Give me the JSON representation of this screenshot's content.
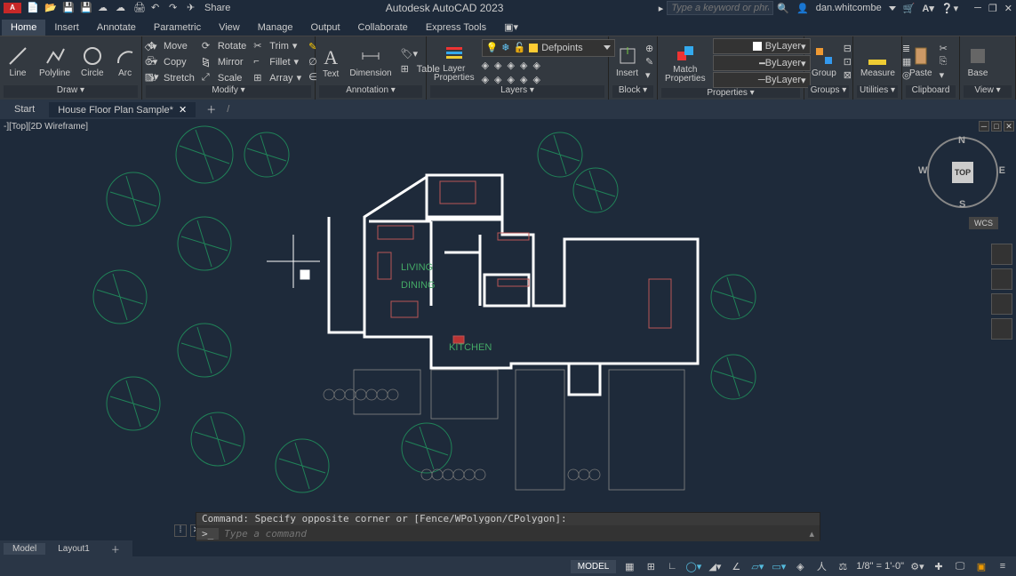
{
  "app": {
    "title": "Autodesk AutoCAD 2023",
    "logo_text": "A CAD",
    "share": "Share",
    "search_placeholder": "Type a keyword or phrase",
    "username": "dan.whitcombe"
  },
  "menu_tabs": [
    "Home",
    "Insert",
    "Annotate",
    "Parametric",
    "View",
    "Manage",
    "Output",
    "Collaborate",
    "Express Tools"
  ],
  "menu_active": 0,
  "ribbon": {
    "draw": {
      "label": "Draw ▾",
      "items": [
        "Line",
        "Polyline",
        "Circle",
        "Arc"
      ]
    },
    "modify": {
      "label": "Modify ▾",
      "move": "Move",
      "rotate": "Rotate",
      "trim": "Trim",
      "copy": "Copy",
      "mirror": "Mirror",
      "fillet": "Fillet",
      "stretch": "Stretch",
      "scale": "Scale",
      "array": "Array"
    },
    "annotation": {
      "label": "Annotation ▾",
      "text": "Text",
      "dimension": "Dimension",
      "table": "Table"
    },
    "layers": {
      "label": "Layers ▾",
      "props": "Layer\nProperties",
      "current": "Defpoints"
    },
    "block": {
      "label": "Block ▾",
      "insert": "Insert"
    },
    "properties": {
      "label": "Properties ▾",
      "match": "Match\nProperties",
      "bylayer": "ByLayer"
    },
    "groups": {
      "label": "Groups ▾",
      "group": "Group"
    },
    "utilities": {
      "label": "Utilities ▾",
      "measure": "Measure"
    },
    "clipboard": {
      "label": "Clipboard",
      "paste": "Paste"
    },
    "view": {
      "label": "View ▾",
      "base": "Base"
    }
  },
  "filetabs": {
    "start": "Start",
    "file": "House Floor Plan Sample*"
  },
  "viewport": {
    "label": "-][Top][2D Wireframe]",
    "cube_top": "TOP",
    "wcs": "WCS",
    "n": "N",
    "s": "S",
    "e": "E",
    "w": "W"
  },
  "rooms": {
    "living": "LIVING",
    "dining": "DINING",
    "kitchen": "KITCHEN"
  },
  "command": {
    "history": "Command: Specify opposite corner or [Fence/WPolygon/CPolygon]:",
    "placeholder": "Type a command",
    "prompt": ">_"
  },
  "layout_tabs": {
    "model": "Model",
    "layout1": "Layout1"
  },
  "status": {
    "model": "MODEL",
    "scale": "1/8\" = 1'-0\""
  }
}
